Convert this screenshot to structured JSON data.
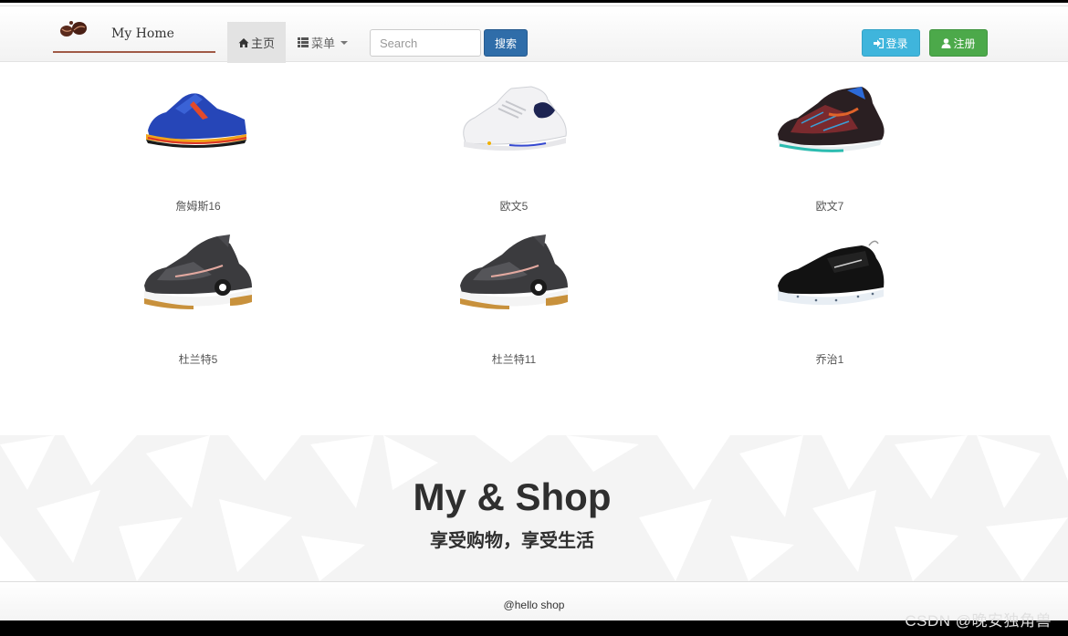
{
  "navbar": {
    "brand": "My Home",
    "home_label": "主页",
    "menu_label": "菜单",
    "search_placeholder": "Search",
    "search_button": "搜索",
    "login_label": "登录",
    "register_label": "注册"
  },
  "products": [
    {
      "name": "詹姆斯16"
    },
    {
      "name": "欧文5"
    },
    {
      "name": "欧文7"
    },
    {
      "name": "杜兰特5"
    },
    {
      "name": "杜兰特11"
    },
    {
      "name": "乔治1"
    }
  ],
  "banner": {
    "title": "My & Shop",
    "subtitle": "享受购物，享受生活"
  },
  "footer": {
    "text": "@hello shop"
  },
  "watermark": "CSDN @晚安独角兽",
  "colors": {
    "search_button": "#2f6da9",
    "login_button": "#3fb5dc",
    "register_button": "#4ca94a",
    "brand_underline": "#a05a46"
  }
}
